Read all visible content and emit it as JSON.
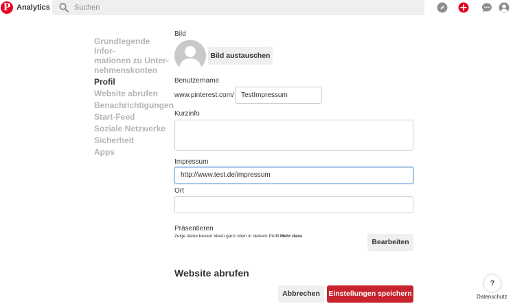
{
  "topbar": {
    "logo_letter": "P",
    "brand": "Analytics",
    "search_placeholder": "Suchen",
    "icons": [
      "compass-icon",
      "plus-icon",
      "chat-icon",
      "profile-icon"
    ]
  },
  "sidebar": {
    "items": [
      {
        "label": "Grundlegende Infor-",
        "line2": "mationen zu Unter-",
        "line3": "nehmenskonten"
      },
      {
        "label": "Profil"
      },
      {
        "label": "Website abrufen"
      },
      {
        "label": "Benachrichtigungen"
      },
      {
        "label": "Start-Feed"
      },
      {
        "label": "Soziale Netzwerke"
      },
      {
        "label": "Sicherheit"
      },
      {
        "label": "Apps"
      }
    ]
  },
  "form": {
    "bild_label": "Bild",
    "replace_button": "Bild austauschen",
    "username_label": "Benutzername",
    "url_prefix": "www.pinterest.com/",
    "username_value": "TestImpressum",
    "kurzinfo_label": "Kurzinfo",
    "kurzinfo_value": "",
    "impressum_label": "Impressum",
    "impressum_value": "http://www.test.de/impressum",
    "ort_label": "Ort",
    "ort_value": "",
    "praesentieren_label": "Präsentieren",
    "praesentieren_desc": "Zeige deine besten Ideen ganz oben in deinem Profil",
    "mehr_dazu": "Mehr dazu",
    "edit_button": "Bearbeiten"
  },
  "section": {
    "website_title": "Website abrufen"
  },
  "footer": {
    "cancel_button": "Abbrechen",
    "save_button": "Einstellungen speichern",
    "help": "?",
    "privacy": "Datenschutz"
  },
  "colors": {
    "brand_red": "#e60023",
    "save_red": "#c8232c",
    "focus_blue": "#a8c6ea"
  }
}
